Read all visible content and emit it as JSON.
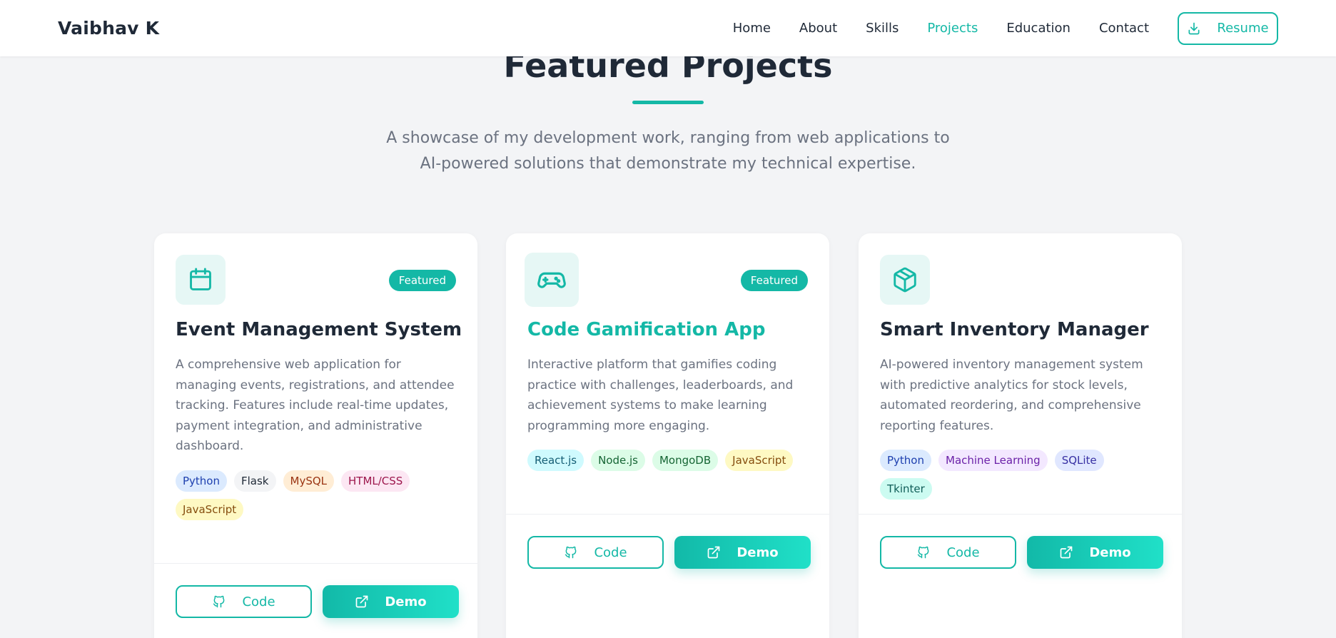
{
  "nav": {
    "brand": "Vaibhav K",
    "links": [
      "Home",
      "About",
      "Skills",
      "Projects",
      "Education",
      "Contact"
    ],
    "active": "Projects",
    "resume_label": "Resume"
  },
  "section": {
    "title": "Featured Projects",
    "subtitle": "A showcase of my development work, ranging from web applications to AI-powered solutions that demonstrate my technical expertise."
  },
  "projects": [
    {
      "icon": "calendar-icon",
      "featured": true,
      "badge": "Featured",
      "title": "Event Management System",
      "description": "A comprehensive web application for managing events, registrations, and attendee tracking. Features include real-time updates, payment integration, and administrative dashboard.",
      "tags": [
        "Python",
        "Flask",
        "MySQL",
        "HTML/CSS",
        "JavaScript"
      ],
      "code_label": "Code",
      "demo_label": "Demo"
    },
    {
      "icon": "gamepad-icon",
      "featured": true,
      "badge": "Featured",
      "title": "Code Gamification App",
      "description": "Interactive platform that gamifies coding practice with challenges, leaderboards, and achievement systems to make learning programming more engaging.",
      "tags": [
        "React.js",
        "Node.js",
        "MongoDB",
        "JavaScript"
      ],
      "code_label": "Code",
      "demo_label": "Demo"
    },
    {
      "icon": "box-icon",
      "featured": false,
      "badge": "",
      "title": "Smart Inventory Manager",
      "description": "AI-powered inventory management system with predictive analytics for stock levels, automated reordering, and comprehensive reporting features.",
      "tags": [
        "Python",
        "Machine Learning",
        "SQLite",
        "Tkinter"
      ],
      "code_label": "Code",
      "demo_label": "Demo"
    }
  ],
  "colors": {
    "accent": "#14b8a6",
    "background": "#f3f4f6",
    "text_dark": "#1f2937",
    "text_muted": "#6b7280"
  }
}
